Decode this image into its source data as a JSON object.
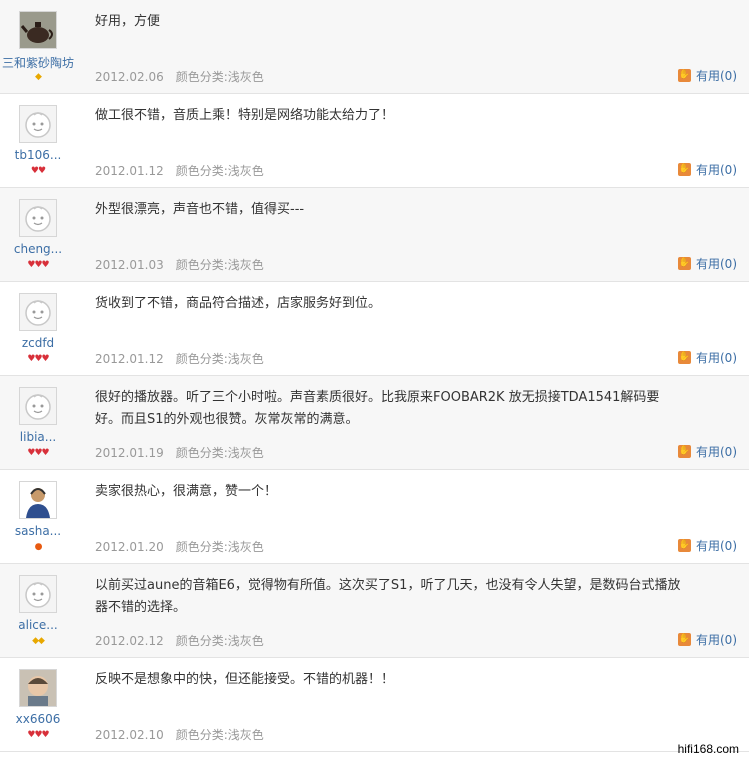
{
  "reviews": [
    {
      "avatar": "teapot-avatar",
      "username": "三和紫砂陶坊",
      "badge_type": "gold",
      "badges": "◆",
      "text": "好用，方便",
      "date": "2012.02.06",
      "color_label": "颜色分类:浅灰色",
      "useful_label": "有用(0)"
    },
    {
      "avatar": "default-smiley-avatar",
      "username": "tb106...",
      "badge_type": "hearts",
      "badges": "♥♥",
      "text": "做工很不错，音质上乘！特别是网络功能太给力了！",
      "date": "2012.01.12",
      "color_label": "颜色分类:浅灰色",
      "useful_label": "有用(0)"
    },
    {
      "avatar": "default-smiley-avatar",
      "username": "cheng...",
      "badge_type": "hearts",
      "badges": "♥♥♥",
      "text": "外型很漂亮，声音也不错，值得买---",
      "date": "2012.01.03",
      "color_label": "颜色分类:浅灰色",
      "useful_label": "有用(0)"
    },
    {
      "avatar": "default-smiley-avatar",
      "username": "zcdfd",
      "badge_type": "hearts",
      "badges": "♥♥♥",
      "text": "货收到了不错，商品符合描述，店家服务好到位。",
      "date": "2012.01.12",
      "color_label": "颜色分类:浅灰色",
      "useful_label": "有用(0)"
    },
    {
      "avatar": "default-smiley-avatar",
      "username": "libia...",
      "badge_type": "hearts",
      "badges": "♥♥♥",
      "text": "很好的播放器。听了三个小时啦。声音素质很好。比我原来FOOBAR2K 放无损接TDA1541解码要好。而且S1的外观也很赞。灰常灰常的满意。",
      "date": "2012.01.19",
      "color_label": "颜色分类:浅灰色",
      "useful_label": "有用(0)"
    },
    {
      "avatar": "headset-person-avatar",
      "username": "sasha...",
      "badge_type": "orange",
      "badges": "●",
      "text": "卖家很热心，很满意，赞一个！",
      "date": "2012.01.20",
      "color_label": "颜色分类:浅灰色",
      "useful_label": "有用(0)"
    },
    {
      "avatar": "default-smiley-avatar",
      "username": "alice...",
      "badge_type": "gold",
      "badges": "◆◆",
      "text": "以前买过aune的音箱E6，觉得物有所值。这次买了S1，听了几天，也没有令人失望，是数码台式播放器不错的选择。",
      "date": "2012.02.12",
      "color_label": "颜色分类:浅灰色",
      "useful_label": "有用(0)"
    },
    {
      "avatar": "baby-photo-avatar",
      "username": "xx6606",
      "badge_type": "hearts",
      "badges": "♥♥♥",
      "text": "反映不是想象中的快，但还能接受。不错的机器！！",
      "date": "2012.02.10",
      "color_label": "颜色分类:浅灰色",
      "useful_label": ""
    }
  ],
  "watermark": "hifi168.com",
  "colors": {
    "username": "#3c6ea5",
    "meta": "#999999",
    "odd_row": "#f7f7f7",
    "thumb": "#e8893a"
  }
}
